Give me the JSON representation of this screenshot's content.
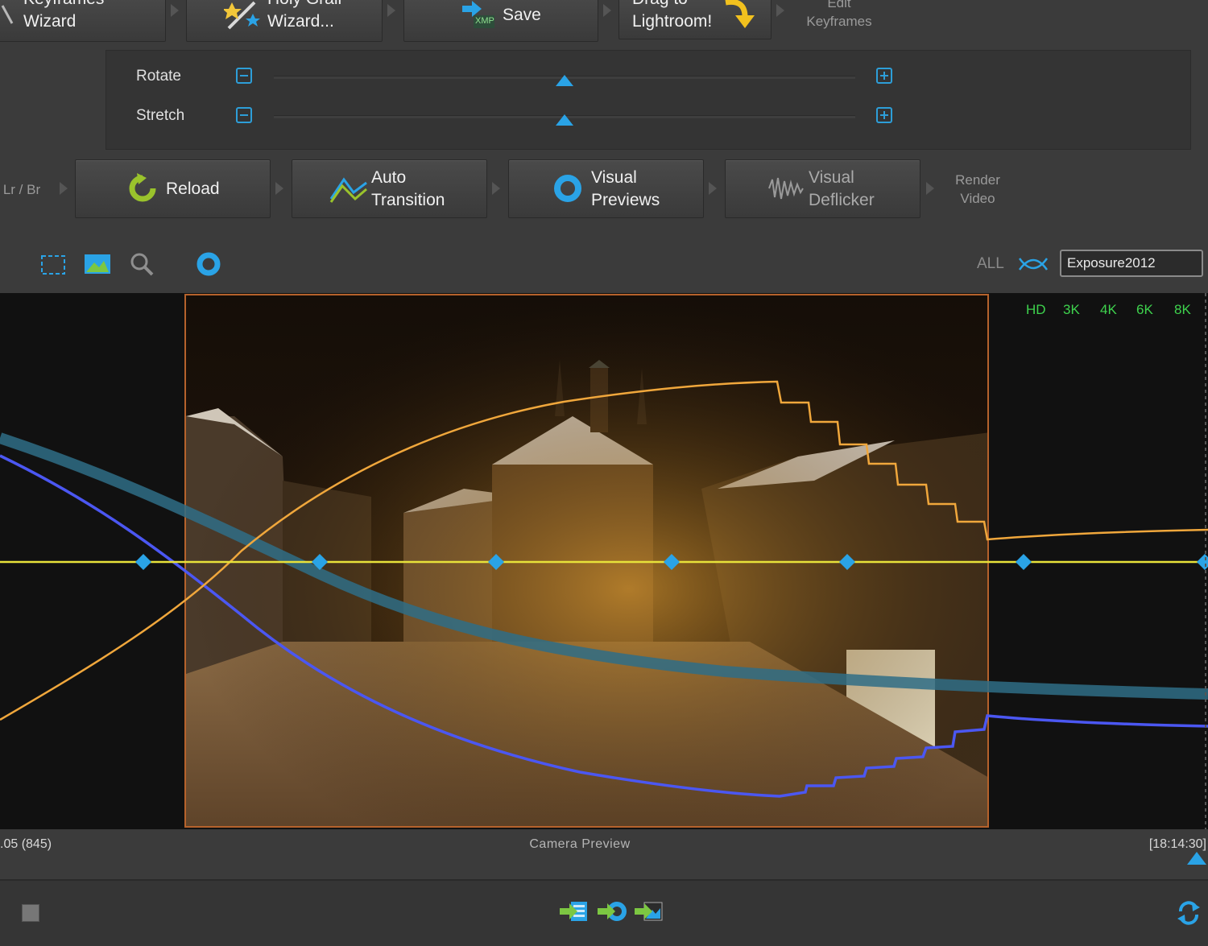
{
  "workflow_top": {
    "keyframes_wizard": "Keyframes\nWizard",
    "holy_grail_wizard": "Holy Grail\nWizard...",
    "save": "Save",
    "xmp_tag": "XMP",
    "drag_to_lightroom": "Drag to\nLightroom!",
    "edit_keyframes": "Edit\nKeyframes"
  },
  "sliders": {
    "rotate_label": "Rotate",
    "stretch_label": "Stretch",
    "rotate_value": 0.5,
    "stretch_value": 0.5
  },
  "workflow_bottom": {
    "lr_br": "Lr / Br",
    "reload": "Reload",
    "auto_transition": "Auto\nTransition",
    "visual_previews": "Visual\nPreviews",
    "visual_deflicker": "Visual\nDeflicker",
    "render_video": "Render\nVideo"
  },
  "toolbar": {
    "all_label": "ALL",
    "preset_value": "Exposure2012"
  },
  "resolutions": [
    "HD",
    "3K",
    "4K",
    "6K",
    "8K"
  ],
  "status": {
    "left": ".05 (845)",
    "center": "Camera Preview",
    "right": "[18:14:30]"
  },
  "colors": {
    "accent": "#2aa3e6",
    "orange_curve": "#f0a73c",
    "blue_curve": "#4b57f2",
    "teal_curve": "#2f6d86",
    "yellow_line": "#e8e23a",
    "res_green": "#3ed24d",
    "photo_border": "#b5622c"
  }
}
